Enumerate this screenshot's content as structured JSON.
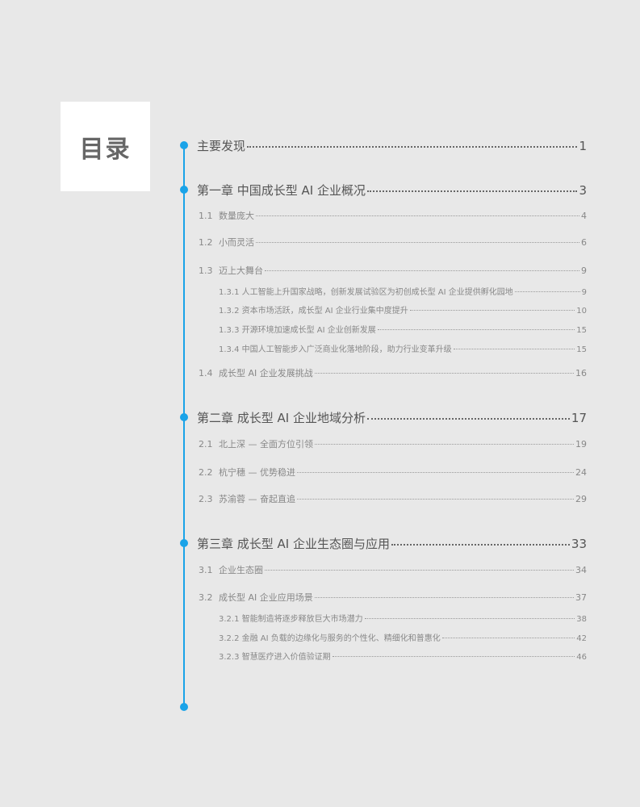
{
  "title": "目录",
  "entries": [
    {
      "level": "ch",
      "label": "主要发现",
      "page": "1"
    },
    {
      "level": "ch",
      "label": "第一章  中国成长型 AI 企业概况",
      "page": "3"
    },
    {
      "level": "sec",
      "num": "1.1",
      "label": "数量庞大",
      "page": "4"
    },
    {
      "level": "sec",
      "num": "1.2",
      "label": "小而灵活",
      "page": "6"
    },
    {
      "level": "sec",
      "num": "1.3",
      "label": "迈上大舞台",
      "page": "9"
    },
    {
      "level": "sub",
      "label": "1.3.1 人工智能上升国家战略，创新发展试验区为初创成长型 AI 企业提供孵化园地",
      "page": "9"
    },
    {
      "level": "sub",
      "label": "1.3.2 资本市场活跃，成长型 AI 企业行业集中度提升",
      "page": "10"
    },
    {
      "level": "sub",
      "label": "1.3.3 开源环境加速成长型 AI 企业创新发展",
      "page": "15"
    },
    {
      "level": "sub",
      "label": "1.3.4 中国人工智能步入广泛商业化落地阶段，助力行业变革升级",
      "page": "15"
    },
    {
      "level": "sec",
      "num": "1.4",
      "label": "成长型 AI 企业发展挑战",
      "page": "16"
    },
    {
      "level": "ch",
      "label": "第二章  成长型 AI 企业地域分析",
      "page": "17"
    },
    {
      "level": "sec",
      "num": "2.1",
      "label": "北上深 — 全面方位引领",
      "page": "19"
    },
    {
      "level": "sec",
      "num": "2.2",
      "label": "杭宁穗 — 优势稳进",
      "page": "24"
    },
    {
      "level": "sec",
      "num": "2.3",
      "label": "苏渝蓉 — 奋起直追",
      "page": "29"
    },
    {
      "level": "ch",
      "label": "第三章  成长型 AI 企业生态圈与应用",
      "page": "33"
    },
    {
      "level": "sec",
      "num": "3.1",
      "label": "企业生态圈",
      "page": "34"
    },
    {
      "level": "sec",
      "num": "3.2",
      "label": "成长型 AI 企业应用场景",
      "page": "37"
    },
    {
      "level": "sub",
      "label": "3.2.1 智能制造将逐步释放巨大市场潜力",
      "page": "38"
    },
    {
      "level": "sub",
      "label": "3.2.2 金融 AI 负载的边缘化与服务的个性化、精细化和普惠化",
      "page": "42"
    },
    {
      "level": "sub",
      "label": "3.2.3 智慧医疗进入价值验证期",
      "page": "46"
    }
  ],
  "accent": "#1aa3e8"
}
